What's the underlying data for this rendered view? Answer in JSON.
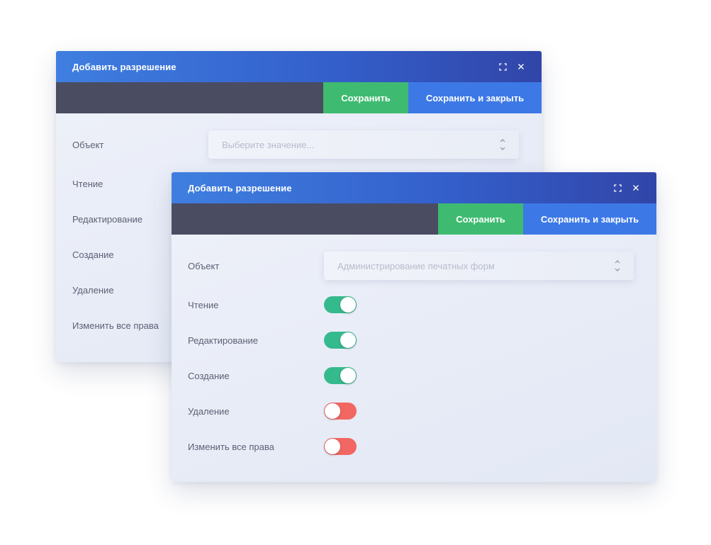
{
  "colors": {
    "titlebar_start": "#3f7fe0",
    "titlebar_end": "#3145a8",
    "toolbar": "#4a4c62",
    "save_button": "#3ebb70",
    "save_close_button": "#3d79e6",
    "toggle_on": "#35ba8e",
    "toggle_off": "#f26762"
  },
  "back_dialog": {
    "title": "Добавить разрешение",
    "toolbar": {
      "save_label": "Сохранить",
      "save_close_label": "Сохранить и закрыть"
    },
    "object": {
      "label": "Объект",
      "placeholder": "Выберите значение..."
    },
    "labels": [
      "Чтение",
      "Редактирование",
      "Создание",
      "Удаление",
      "Изменить все права"
    ]
  },
  "front_dialog": {
    "title": "Добавить разрешение",
    "toolbar": {
      "save_label": "Сохранить",
      "save_close_label": "Сохранить и закрыть"
    },
    "object": {
      "label": "Объект",
      "value": "Администрирование печатных форм"
    },
    "permissions": [
      {
        "label": "Чтение",
        "enabled": true
      },
      {
        "label": "Редактирование",
        "enabled": true
      },
      {
        "label": "Создание",
        "enabled": true
      },
      {
        "label": "Удаление",
        "enabled": false
      },
      {
        "label": "Изменить все права",
        "enabled": false
      }
    ]
  },
  "icons": {
    "maximize": "expand-corners-icon",
    "close": "close-x-icon",
    "select": "chevron-up-down-icon"
  }
}
